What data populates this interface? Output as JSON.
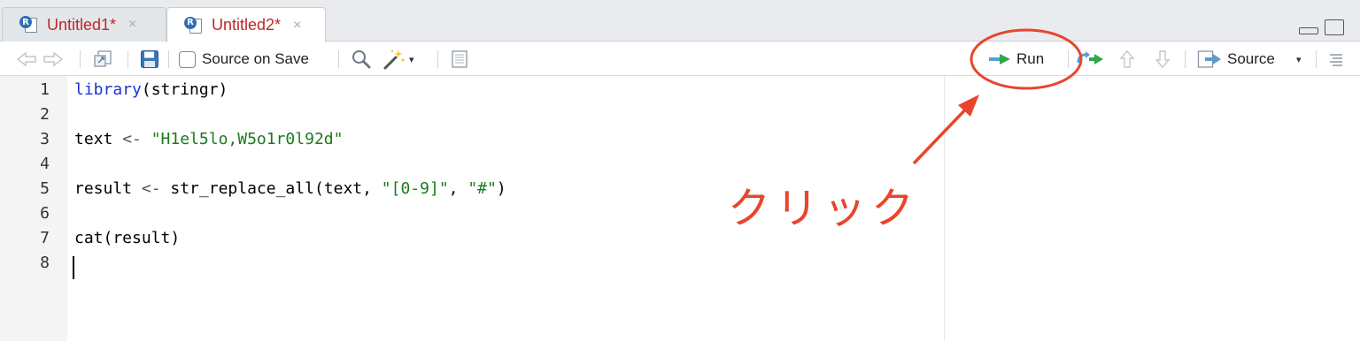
{
  "tabs": [
    {
      "label": "Untitled1*",
      "icon": "r-script-icon",
      "badge": "R",
      "close": "×",
      "active": false
    },
    {
      "label": "Untitled2*",
      "icon": "r-script-icon",
      "badge": "R",
      "close": "×",
      "active": true
    }
  ],
  "toolbar": {
    "source_on_save_label": "Source on Save",
    "source_on_save_checked": false,
    "run_label": "Run",
    "source_label": "Source",
    "dropdown_glyph": "▾"
  },
  "editor": {
    "lines": [
      {
        "num": "1"
      },
      {
        "num": "2"
      },
      {
        "num": "3"
      },
      {
        "num": "4"
      },
      {
        "num": "5"
      },
      {
        "num": "6"
      },
      {
        "num": "7"
      },
      {
        "num": "8"
      }
    ],
    "code": {
      "l1_fn": "library",
      "l1_rest": "(stringr)",
      "l3_var": "text ",
      "l3_op": "<-",
      "l3_str": "\"H1el5lo,W5o1r0l92d\"",
      "l5_var": "result ",
      "l5_op": "<-",
      "l5_call": " str_replace_all(text, ",
      "l5_str1": "\"[0-9]\"",
      "l5_comma": ", ",
      "l5_str2": "\"#\"",
      "l5_close": ")",
      "l7": "cat(result)"
    }
  },
  "annotation": {
    "text": "クリック",
    "color": "#e8452c"
  }
}
